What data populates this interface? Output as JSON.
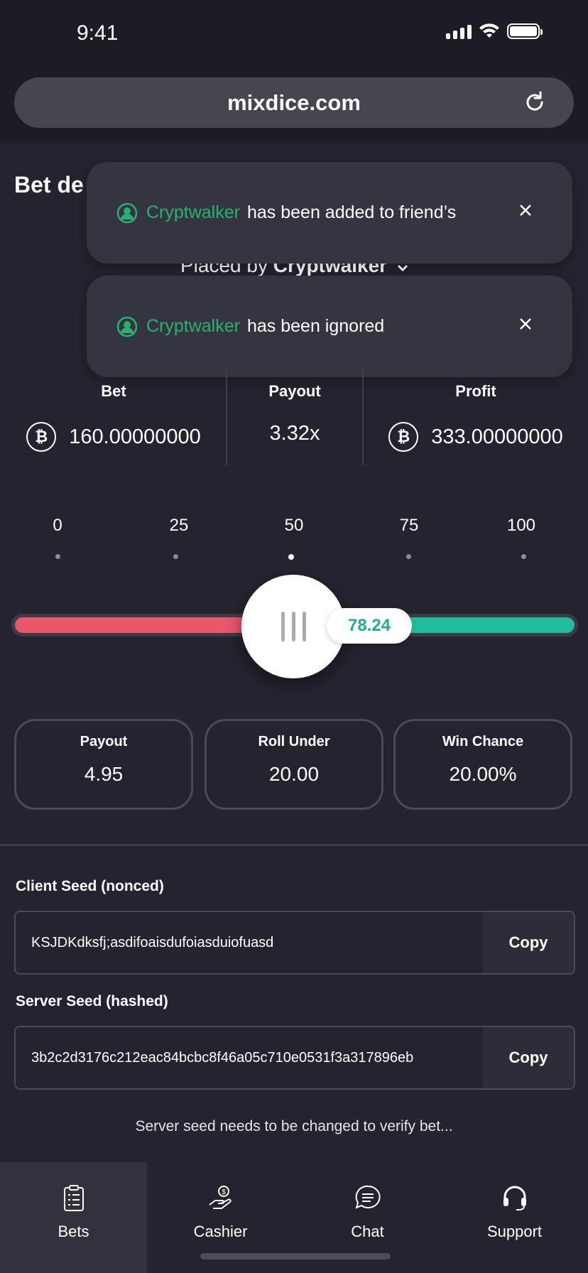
{
  "status_bar": {
    "time": "9:41"
  },
  "browser": {
    "url": "mixdice.com"
  },
  "page": {
    "title": "Bet de",
    "placed_by_prefix": "Placed by",
    "placed_by_user": "Cryptwalker"
  },
  "toasts": [
    {
      "name": "Cryptwalker",
      "message": "has been added to friend’s"
    },
    {
      "name": "Cryptwalker",
      "message": "has been ignored"
    }
  ],
  "stats": {
    "bet_label": "Bet",
    "bet_value": "160.00000000",
    "payout_label": "Payout",
    "payout_value": "3.32x",
    "profit_label": "Profit",
    "profit_value": "333.00000000",
    "currency_symbol": "₿"
  },
  "slider": {
    "ticks": [
      "0",
      "25",
      "50",
      "75",
      "100"
    ],
    "value": "78.24",
    "split_percent": 50
  },
  "info": {
    "payout_label": "Payout",
    "payout_value": "4.95",
    "roll_under_label": "Roll Under",
    "roll_under_value": "20.00",
    "win_chance_label": "Win Chance",
    "win_chance_value": "20.00%"
  },
  "seeds": {
    "client_label": "Client Seed (nonced)",
    "client_value": "KSJDKdksfj;asdifoaisdufoiasduiofuasd",
    "server_label": "Server Seed (hashed)",
    "server_value": "3b2c2d3176c212eac84bcbc8f46a05c710e0531f3a317896eb",
    "copy_label": "Copy"
  },
  "notice": "Server seed needs to be changed to verify bet...",
  "tabs": [
    {
      "label": "Bets",
      "icon": "clipboard-icon",
      "active": true
    },
    {
      "label": "Cashier",
      "icon": "cashier-icon",
      "active": false
    },
    {
      "label": "Chat",
      "icon": "chat-icon",
      "active": false
    },
    {
      "label": "Support",
      "icon": "headset-icon",
      "active": false
    }
  ],
  "colors": {
    "background": "#23242f",
    "accent_green": "#1fbe9c",
    "accent_red": "#ec566b",
    "friend_name": "#26b36f"
  }
}
